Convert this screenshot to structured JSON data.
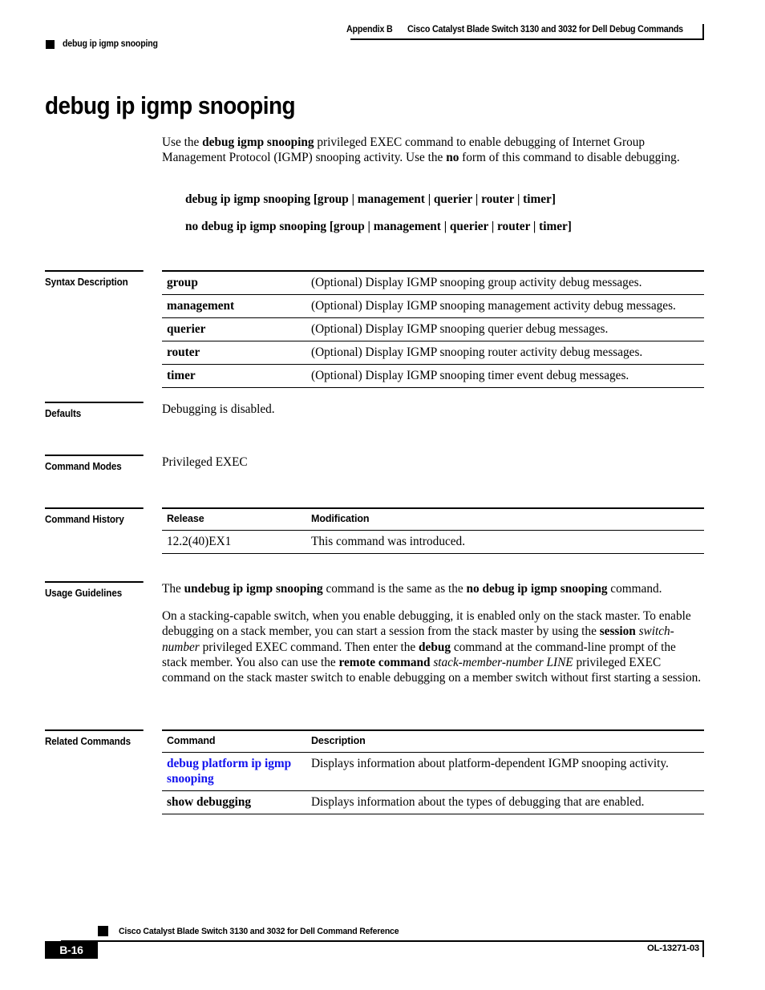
{
  "header": {
    "appendix": "Appendix B",
    "book_title": "Cisco Catalyst Blade Switch 3130 and 3032 for Dell Debug Commands",
    "command_name": "debug ip igmp snooping"
  },
  "page_title": "debug ip igmp snooping",
  "intro": {
    "p1_a": "Use the ",
    "p1_b": "debug igmp snooping",
    "p1_c": " privileged EXEC command to enable debugging of Internet Group Management Protocol (IGMP) snooping activity. Use the ",
    "p1_d": "no",
    "p1_e": " form of this command to disable debugging."
  },
  "syntax": {
    "line1": "debug ip igmp snooping [group | management | querier | router | timer]",
    "line2": "no debug ip igmp snooping [group | management | querier | router | timer]"
  },
  "sections": {
    "syntax_description": "Syntax Description",
    "defaults": "Defaults",
    "command_modes": "Command Modes",
    "command_history": "Command History",
    "usage_guidelines": "Usage Guidelines",
    "related_commands": "Related Commands"
  },
  "syntax_description_table": {
    "rows": [
      {
        "term": "group",
        "description": "(Optional) Display IGMP snooping group activity debug messages."
      },
      {
        "term": "management",
        "description": "(Optional) Display IGMP snooping management activity debug messages."
      },
      {
        "term": "querier",
        "description": "(Optional) Display IGMP snooping querier debug messages."
      },
      {
        "term": "router",
        "description": "(Optional) Display IGMP snooping router activity debug messages."
      },
      {
        "term": "timer",
        "description": "(Optional) Display IGMP snooping timer event debug messages."
      }
    ]
  },
  "defaults": {
    "text": "Debugging is disabled."
  },
  "command_modes": {
    "text": "Privileged EXEC"
  },
  "command_history_table": {
    "headers": {
      "release": "Release",
      "modification": "Modification"
    },
    "rows": [
      {
        "release": "12.2(40)EX1",
        "modification": "This command was introduced."
      }
    ]
  },
  "usage_guidelines": {
    "p1_a": "The ",
    "p1_b": "undebug ip igmp snooping",
    "p1_c": " command is the same as the ",
    "p1_d": "no debug ip igmp snooping",
    "p1_e": " command.",
    "p2_a": "On a stacking-capable switch, when you enable debugging, it is enabled only on the stack master. To enable debugging on a stack member, you can start a session from the stack master by using the ",
    "p2_b": "session",
    "p2_c": " ",
    "p2_d": "switch-number",
    "p2_e": " privileged EXEC command. Then enter the ",
    "p2_f": "debug",
    "p2_g": " command at the command-line prompt of the stack member. You also can use the ",
    "p2_h": "remote command",
    "p2_i": " ",
    "p2_j": "stack-member-number LINE",
    "p2_k": " privileged EXEC command on the stack master switch to enable debugging on a member switch without first starting a session."
  },
  "related_commands_table": {
    "headers": {
      "command": "Command",
      "description": "Description"
    },
    "rows": [
      {
        "command": "debug platform ip igmp snooping",
        "link": true,
        "description": "Displays information about platform-dependent IGMP snooping activity."
      },
      {
        "command": "show debugging",
        "link": false,
        "description": "Displays information about the types of debugging that are enabled."
      }
    ]
  },
  "footer": {
    "book_title": "Cisco Catalyst Blade Switch 3130 and 3032 for Dell Command Reference",
    "page_number": "B-16",
    "doc_id": "OL-13271-03"
  },
  "colors": {
    "link": "#1111ee",
    "rule": "#000000",
    "page_background": "#ffffff"
  }
}
